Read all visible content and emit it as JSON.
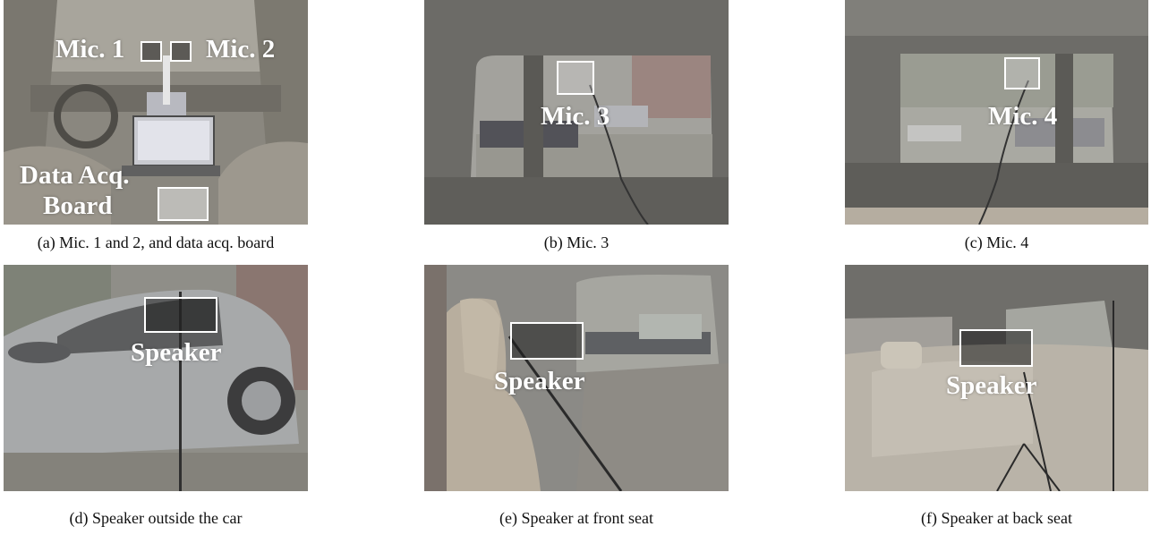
{
  "panels": {
    "a": {
      "caption": "(a) Mic. 1 and 2, and data acq. board",
      "labels": {
        "mic1": "Mic. 1",
        "mic2": "Mic. 2",
        "board_line1": "Data Acq.",
        "board_line2": "Board"
      }
    },
    "b": {
      "caption": "(b) Mic. 3",
      "labels": {
        "mic3": "Mic. 3"
      }
    },
    "c": {
      "caption": "(c) Mic. 4",
      "labels": {
        "mic4": "Mic. 4"
      }
    },
    "d": {
      "caption": "(d) Speaker outside the car",
      "labels": {
        "speaker": "Speaker"
      }
    },
    "e": {
      "caption": "(e) Speaker at front seat",
      "labels": {
        "speaker": "Speaker"
      }
    },
    "f": {
      "caption": "(f) Speaker at back seat",
      "labels": {
        "speaker": "Speaker"
      }
    }
  }
}
